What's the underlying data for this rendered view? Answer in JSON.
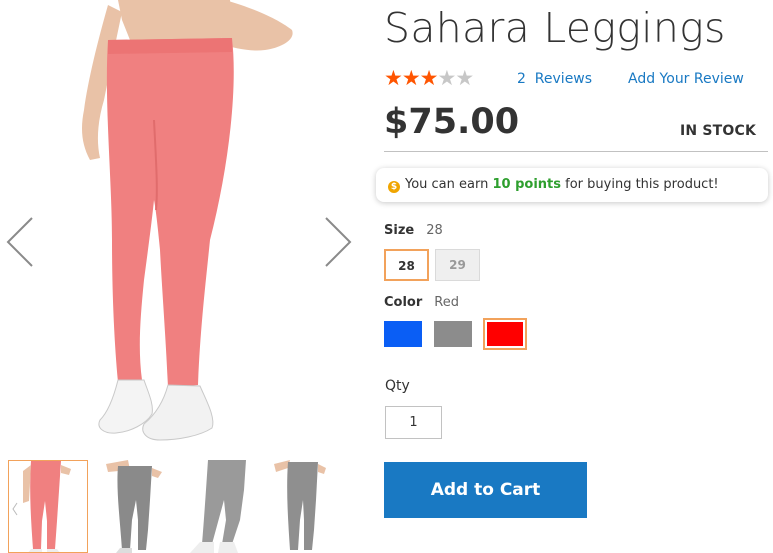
{
  "product": {
    "title": "Sahara Leggings",
    "rating": {
      "filled": 3,
      "total": 5
    },
    "reviews_link": "2  Reviews",
    "add_review_link": "Add Your Review",
    "price": "$75.00",
    "stock": "IN STOCK"
  },
  "points": {
    "prefix": "You can earn ",
    "amount": "10 points",
    "suffix": " for buying this product!"
  },
  "options": {
    "size": {
      "label": "Size",
      "selected": "28",
      "choices": [
        "28",
        "29"
      ]
    },
    "color": {
      "label": "Color",
      "selected": "Red",
      "choices": [
        {
          "name": "Blue",
          "hex": "#0a5ef5"
        },
        {
          "name": "Gray",
          "hex": "#8c8c8c"
        },
        {
          "name": "Red",
          "hex": "#ff0000"
        }
      ]
    }
  },
  "qty": {
    "label": "Qty",
    "value": "1"
  },
  "add_to_cart": "Add to Cart",
  "gallery": {
    "main_image": "pink-leggings-model",
    "thumbnails": [
      "pink-leggings-thumb",
      "gray-leggings-thumb-1",
      "gray-leggings-thumb-2",
      "gray-leggings-thumb-3"
    ],
    "prev_icon": "chevron-left-icon",
    "next_icon": "chevron-right-icon"
  },
  "colors": {
    "accent": "#1979c3",
    "star": "#ff5501",
    "points_green": "#2e9f2e",
    "selected_border": "#f2a25b"
  }
}
